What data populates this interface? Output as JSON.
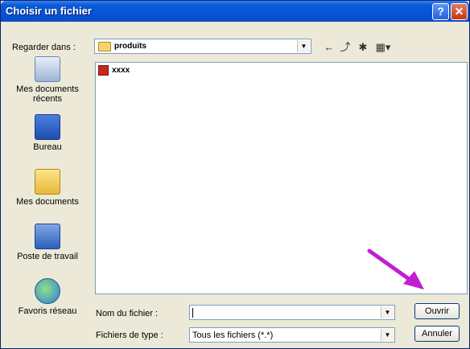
{
  "window": {
    "title": "Choisir un fichier",
    "help_label": "?",
    "close_label": "✕"
  },
  "lookin": {
    "label": "Regarder dans :",
    "value": "produits"
  },
  "toolbar": {
    "back_icon": "←",
    "up_icon": "⤴",
    "newfolder_icon": "✱",
    "views_icon": "▦▾"
  },
  "places": [
    {
      "label": "Mes documents récents",
      "icon": "recent-documents-icon"
    },
    {
      "label": "Bureau",
      "icon": "desktop-icon"
    },
    {
      "label": "Mes documents",
      "icon": "my-documents-icon"
    },
    {
      "label": "Poste de travail",
      "icon": "my-computer-icon"
    },
    {
      "label": "Favoris réseau",
      "icon": "network-places-icon"
    }
  ],
  "files": [
    {
      "name": "xxxx"
    }
  ],
  "filename": {
    "label": "Nom du fichier :",
    "value": ""
  },
  "filetype": {
    "label": "Fichiers de type :",
    "value": "Tous les fichiers (*.*)"
  },
  "buttons": {
    "open": "Ouvrir",
    "cancel": "Annuler"
  },
  "colors": {
    "titlebar": "#0453d6",
    "annotation_arrow": "#c21fd0",
    "dialog_bg": "#ece9d8"
  }
}
